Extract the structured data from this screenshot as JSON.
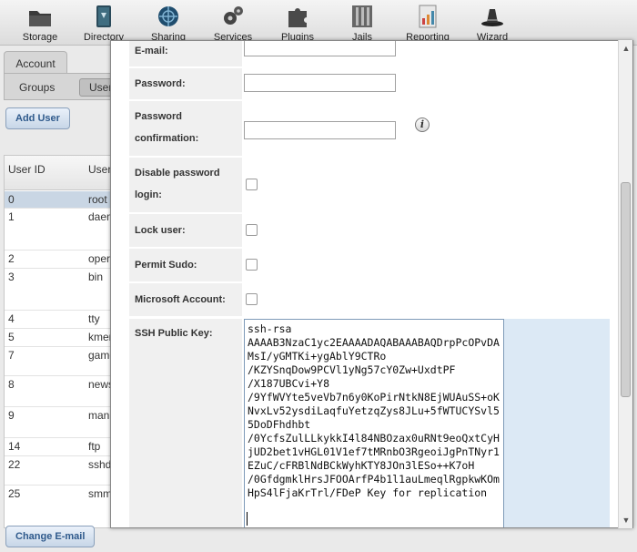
{
  "toolbar": {
    "items": [
      {
        "label": "Storage",
        "icon": "folder-icon"
      },
      {
        "label": "Directory",
        "icon": "directory-book-icon"
      },
      {
        "label": "Sharing",
        "icon": "sharing-globe-icon"
      },
      {
        "label": "Services",
        "icon": "services-gears-icon"
      },
      {
        "label": "Plugins",
        "icon": "plugins-puzzle-icon"
      },
      {
        "label": "Jails",
        "icon": "jails-bars-icon"
      },
      {
        "label": "Reporting",
        "icon": "reporting-chart-icon"
      },
      {
        "label": "Wizard",
        "icon": "wizard-hat-icon"
      }
    ]
  },
  "account": {
    "tab_label": "Account",
    "subtabs": {
      "groups": "Groups",
      "users": "Users"
    },
    "add_user_label": "Add User",
    "change_email_label": "Change E-mail",
    "table": {
      "columns": [
        "User ID",
        "Username"
      ],
      "rows": [
        {
          "id": "0",
          "name": "root"
        },
        {
          "id": "1",
          "name": "daemon"
        },
        {
          "id": "2",
          "name": "operator"
        },
        {
          "id": "3",
          "name": "bin"
        },
        {
          "id": "4",
          "name": "tty"
        },
        {
          "id": "5",
          "name": "kmem"
        },
        {
          "id": "7",
          "name": "games"
        },
        {
          "id": "8",
          "name": "news"
        },
        {
          "id": "9",
          "name": "man"
        },
        {
          "id": "14",
          "name": "ftp"
        },
        {
          "id": "22",
          "name": "sshd"
        },
        {
          "id": "25",
          "name": "smmsp"
        }
      ]
    }
  },
  "form": {
    "email_label": "E-mail:",
    "email_value": "",
    "password_label": "Password:",
    "password_confirm_label_1": "Password",
    "password_confirm_label_2": "confirmation:",
    "disable_password_label_1": "Disable password",
    "disable_password_label_2": "login:",
    "lock_user_label": "Lock user:",
    "permit_sudo_label": "Permit Sudo:",
    "microsoft_account_label": "Microsoft Account:",
    "ssh_label": "SSH Public Key:",
    "ssh_value": "ssh-rsa\nAAAAB3NzaC1yc2EAAAADAQABAAABAQDrpPcOPvDAMsI/yGMTKi+ygAblY9CTRo\n/KZYSnqDow9PCVl1yNg57cY0Zw+UxdtPF\n/X187UBCvi+Y8\n/9YfWVYte5veVb7n6y0KoPirNtkN8EjWUAuSS+oKNvxLv52ysdiLaqfuYetzqZys8JLu+5fWTUCYSvl55DoDFhdhbt\n/0YcfsZulLLkykkI4l84NBOzax0uRNt9eoQxtCyHjUD2bet1vHGL01V1ef7tMRnbO3RgeoiJgPnTNyr1EZuC/cFRBlNdBCkWyhKTY8JOn3lESo++K7oH\n/0GfdgmklHrsJFOOArfP4b1l1auLmeqlRgpkwKOmHpS4lFjaKrTrl/FDeP Key for replication",
    "disable_password_checked": false,
    "lock_user_checked": false,
    "permit_sudo_checked": false,
    "microsoft_account_checked": false
  }
}
